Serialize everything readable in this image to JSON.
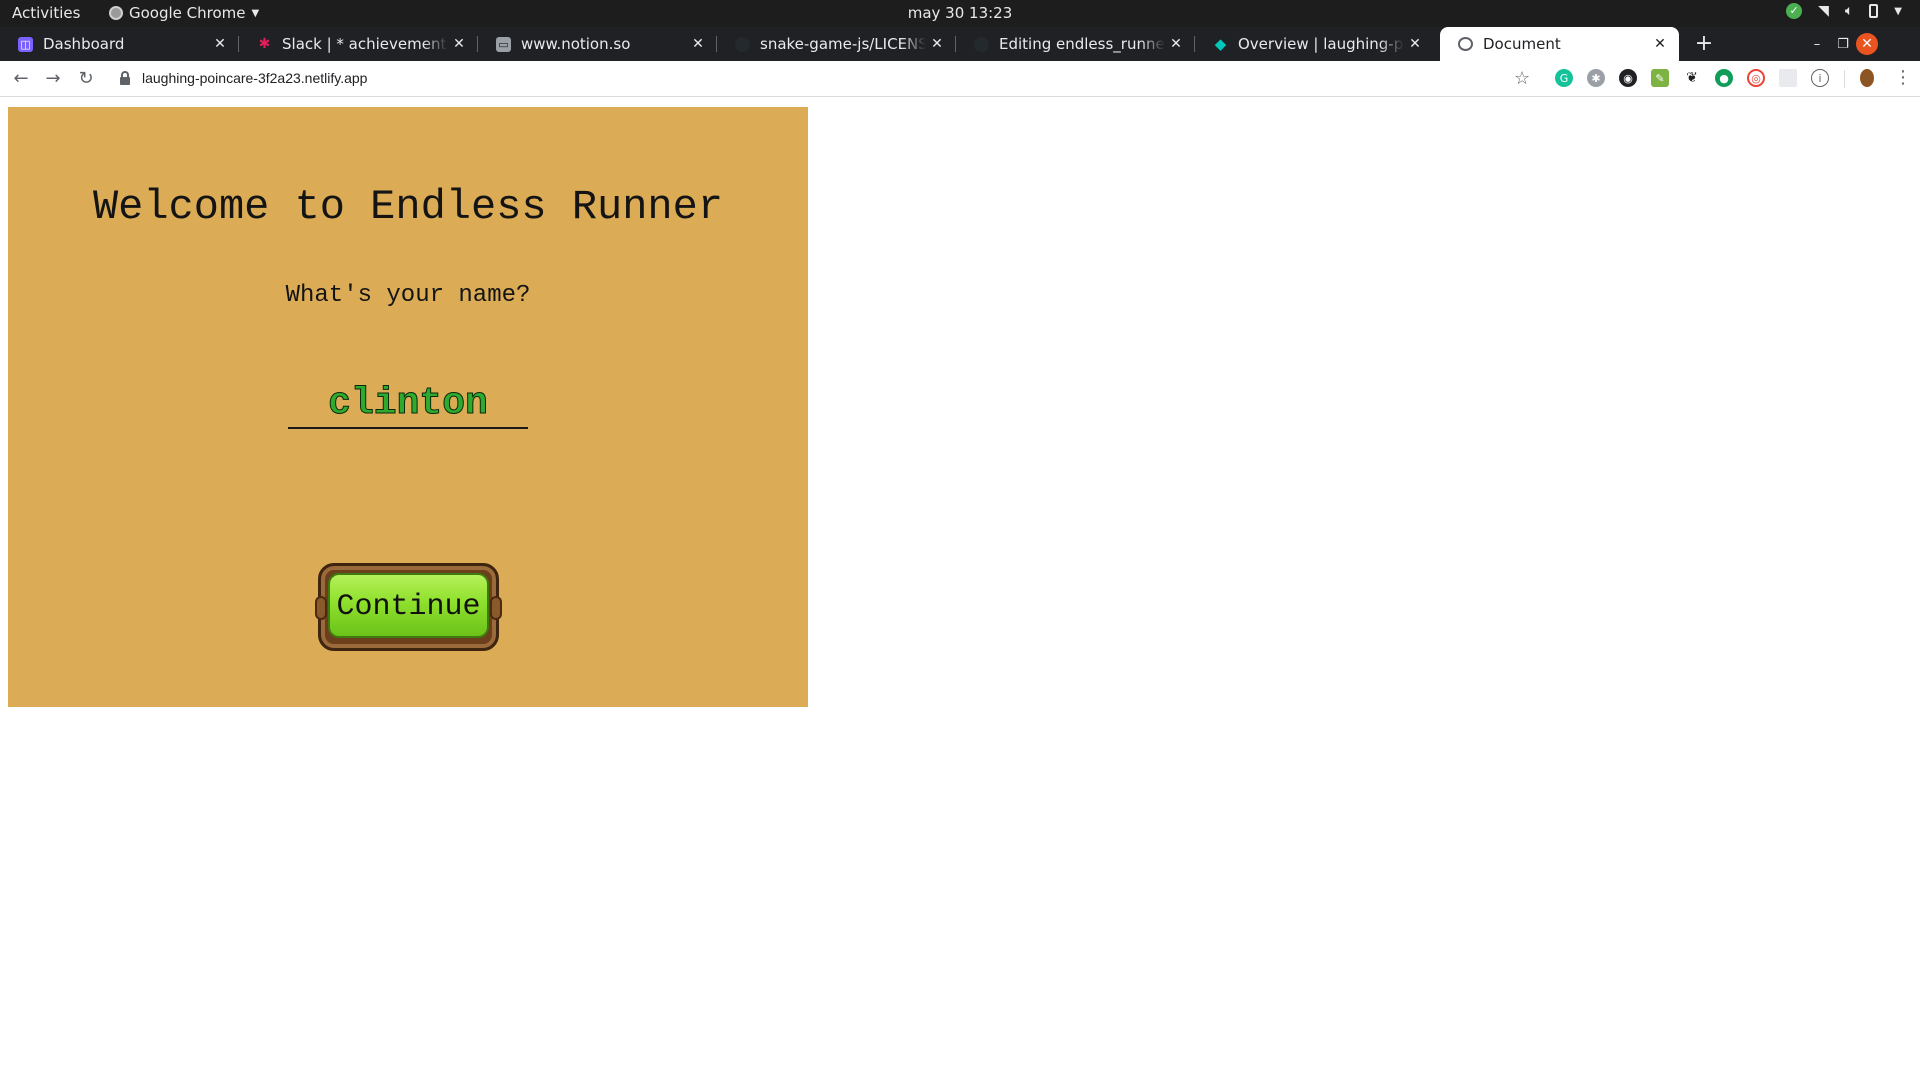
{
  "topbar": {
    "activities": "Activities",
    "app_name": "Google Chrome",
    "clock": "may 30  13:23"
  },
  "tabs": [
    {
      "title": "Dashboard",
      "icon": "dashboard-favicon",
      "color": "#7b61ff"
    },
    {
      "title": "Slack | * achievements | Mi",
      "icon": "slack-favicon",
      "color": "#e01e5a"
    },
    {
      "title": "www.notion.so",
      "icon": "notion-favicon",
      "color": "#9aa0a6"
    },
    {
      "title": "snake-game-js/LICENSE at",
      "icon": "github-favicon",
      "color": "#24292e"
    },
    {
      "title": "Editing endless_runner_g",
      "icon": "github-favicon",
      "color": "#24292e"
    },
    {
      "title": "Overview | laughing-poinc",
      "icon": "netlify-favicon",
      "color": "#00c7b7"
    },
    {
      "title": "Document",
      "icon": "globe-favicon",
      "color": "#5f6368",
      "active": true
    }
  ],
  "toolbar": {
    "url": "laughing-poincare-3f2a23.netlify.app"
  },
  "game": {
    "title": "Welcome to Endless Runner",
    "question": "What's your name?",
    "name_value": "clinton",
    "continue_label": "Continue",
    "background_color": "#dbac55"
  }
}
